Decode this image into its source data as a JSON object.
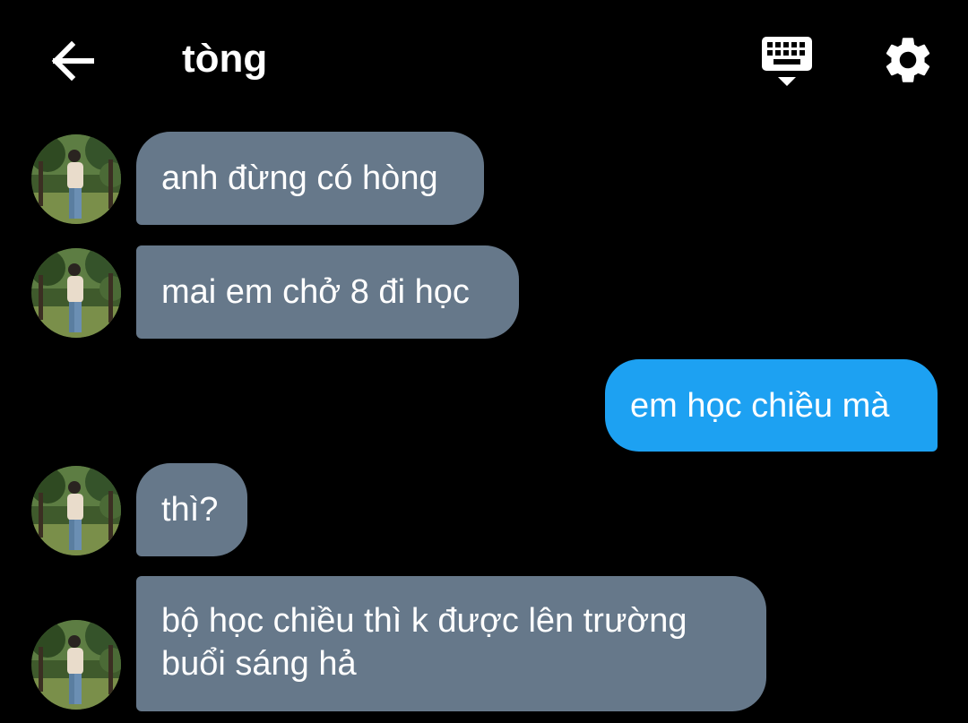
{
  "header": {
    "title": "tòng",
    "back_icon": "arrow-left-icon",
    "keyboard_icon": "keyboard-icon",
    "settings_icon": "gear-icon"
  },
  "messages": [
    {
      "side": "incoming",
      "text": "anh đừng có hòng"
    },
    {
      "side": "incoming",
      "text": "mai em chở 8 đi học"
    },
    {
      "side": "outgoing",
      "text": "em học chiều mà"
    },
    {
      "side": "incoming",
      "text": "thì?"
    },
    {
      "side": "incoming",
      "text": "bộ học chiều thì k được lên trường buổi sáng hả",
      "lines": [
        "bộ học chiều thì k được lên trường",
        "buổi sáng hả"
      ]
    }
  ],
  "colors": {
    "background": "#000000",
    "incoming_bubble": "#66788a",
    "outgoing_bubble": "#1da1f2",
    "text": "#ffffff"
  }
}
